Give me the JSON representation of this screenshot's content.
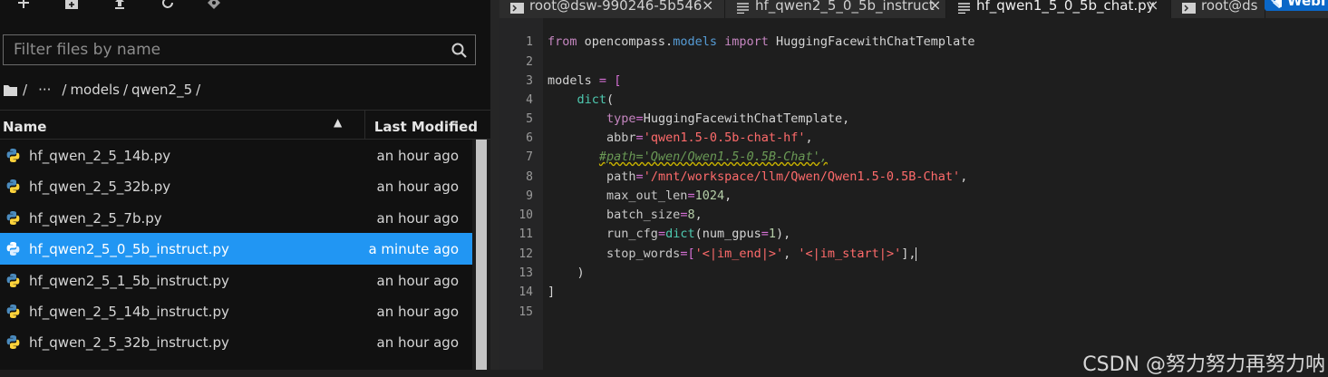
{
  "toolbar": {
    "icons": [
      "plus-icon",
      "new-folder-icon",
      "upload-icon",
      "refresh-icon",
      "git-icon"
    ]
  },
  "filter": {
    "placeholder": "Filter files by name",
    "value": ""
  },
  "breadcrumb": {
    "root": "/",
    "ellipsis": "···",
    "parts": [
      "models",
      "qwen2_5"
    ],
    "separator": "/"
  },
  "file_list": {
    "headers": {
      "name": "Name",
      "last_modified": "Last Modified"
    },
    "rows": [
      {
        "name": "hf_qwen_2_5_14b.py",
        "modified": "an hour ago",
        "selected": false
      },
      {
        "name": "hf_qwen_2_5_32b.py",
        "modified": "an hour ago",
        "selected": false
      },
      {
        "name": "hf_qwen_2_5_7b.py",
        "modified": "an hour ago",
        "selected": false
      },
      {
        "name": "hf_qwen2_5_0_5b_instruct.py",
        "modified": "a minute ago",
        "selected": true
      },
      {
        "name": "hf_qwen2_5_1_5b_instruct.py",
        "modified": "an hour ago",
        "selected": false
      },
      {
        "name": "hf_qwen_2_5_14b_instruct.py",
        "modified": "an hour ago",
        "selected": false
      },
      {
        "name": "hf_qwen_2_5_32b_instruct.py",
        "modified": "an hour ago",
        "selected": false
      }
    ]
  },
  "tabs": [
    {
      "label": "root@dsw-990246-5b546",
      "icon": "terminal-icon",
      "close": "×",
      "active": false
    },
    {
      "label": "hf_qwen2_5_0_5b_instruct",
      "icon": "file-text-icon",
      "close": "×",
      "active": false
    },
    {
      "label": "hf_qwen1_5_0_5b_chat.py",
      "icon": "file-text-icon",
      "close": "×",
      "active": true
    },
    {
      "label": "root@ds",
      "icon": "terminal-icon",
      "close": "",
      "active": false
    }
  ],
  "web_badge": {
    "label": "WebI"
  },
  "editor": {
    "line_numbers": [
      "1",
      "2",
      "3",
      "4",
      "5",
      "6",
      "7",
      "8",
      "9",
      "10",
      "11",
      "12",
      "13",
      "14",
      "15"
    ],
    "lines": {
      "l1": {
        "from": "from",
        "module": "opencompass.",
        "models": "models",
        "import": "import",
        "cls": "HuggingFacewithChatTemplate"
      },
      "l3": {
        "name": "models",
        "eq": "=",
        "bracket": "["
      },
      "l4": {
        "fn": "dict",
        "paren": "("
      },
      "l5": {
        "key": "type",
        "eq": "=",
        "val": "HuggingFacewithChatTemplate",
        "tail": ","
      },
      "l6": {
        "key": "abbr",
        "eq": "=",
        "val": "'qwen1.5-0.5b-chat-hf'",
        "tail": ","
      },
      "l7": {
        "comment": "#path='Qwen/Qwen1.5-0.5B-Chat',"
      },
      "l8": {
        "key": "path",
        "eq": "=",
        "val": "'/mnt/workspace/llm/Qwen/Qwen1.5-0.5B-Chat'",
        "tail": ","
      },
      "l9": {
        "key": "max_out_len",
        "eq": "=",
        "val": "1024",
        "tail": ","
      },
      "l10": {
        "key": "batch_size",
        "eq": "=",
        "val": "8",
        "tail": ","
      },
      "l11": {
        "key": "run_cfg",
        "eq": "=",
        "fn": "dict",
        "open": "(",
        "arg": "num_gpus",
        "eq2": "=",
        "num": "1",
        "tail": "),"
      },
      "l12": {
        "key": "stop_words",
        "eq": "=",
        "open": "[",
        "s1": "'<|im_end|>'",
        "comma": ", ",
        "s2": "'<|im_start|>'",
        "tail": "],"
      },
      "l13": {
        "text": ")"
      },
      "l14": {
        "text": "]"
      }
    }
  },
  "watermark": "CSDN @努力努力再努力呐"
}
